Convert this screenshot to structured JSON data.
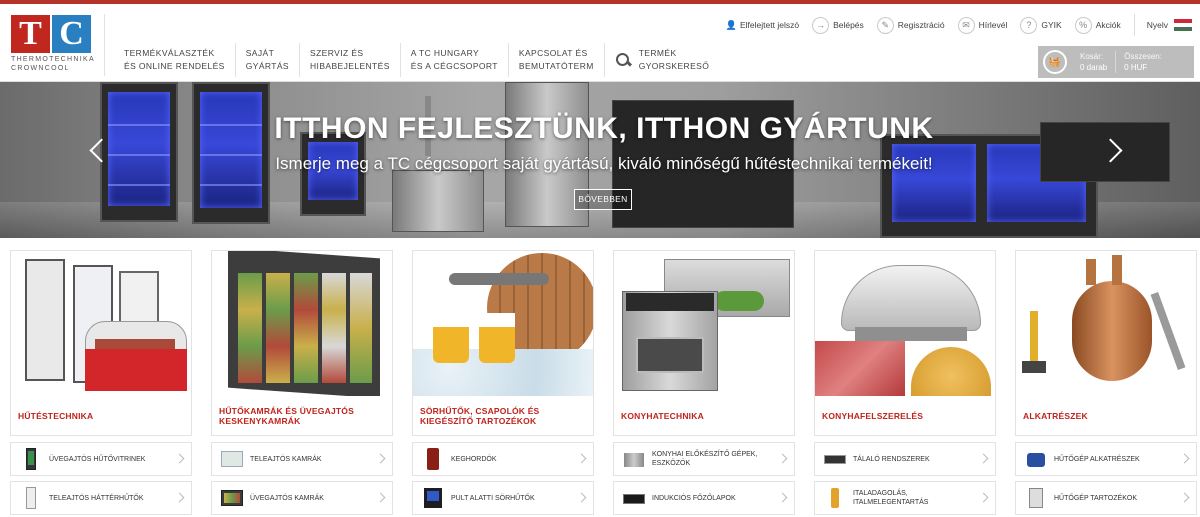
{
  "brand": {
    "logo_letters": [
      "T",
      "C"
    ],
    "logo_line1": "THERMOTECHNIKA",
    "logo_line2": "CROWNCOOL",
    "colors": {
      "accent_red": "#c0231c",
      "logo_blue": "#2a7fc1",
      "top_line": "#b5342a"
    }
  },
  "utility": {
    "forgot_password": "Elfelejtett jelszó",
    "login": "Belépés",
    "register": "Regisztráció",
    "newsletter": "Hírlevél",
    "faq": "GYIK",
    "promotions": "Akciók",
    "language": "Nyelv",
    "icons": [
      "user-icon",
      "login-arrow-icon",
      "register-icon",
      "newsletter-icon",
      "faq-icon",
      "promotions-icon",
      "hungary-flag-icon"
    ]
  },
  "nav": {
    "items": [
      {
        "line1": "TERMÉKVÁLASZTÉK",
        "line2": "ÉS ONLINE RENDELÉS"
      },
      {
        "line1": "SAJÁT",
        "line2": "GYÁRTÁS"
      },
      {
        "line1": "SZERVIZ ÉS",
        "line2": "HIBABEJELENTÉS"
      },
      {
        "line1": "A TC HUNGARY",
        "line2": "ÉS A CÉGCSOPORT"
      },
      {
        "line1": "KAPCSOLAT ÉS",
        "line2": "BEMUTATÓTERM"
      }
    ],
    "search": {
      "line1": "TERMÉK",
      "line2": "GYORSKERESŐ"
    }
  },
  "cart": {
    "cart_label": "Kosár:",
    "cart_value": "0 darab",
    "total_label": "Összesen:",
    "total_value": "0 HUF"
  },
  "hero": {
    "title": "ITTHON FEJLESZTÜNK, ITTHON GYÁRTUNK",
    "subtitle": "Ismerje meg a TC cégcsoport saját gyártású, kiváló minőségű hűtéstechnikai termékeit!",
    "button": "BŐVEBBEN"
  },
  "categories": [
    {
      "title": "HŰTÉSTECHNIKA",
      "subs": [
        {
          "label": "ÜVEGAJTÓS HŰTŐVITRINEK"
        },
        {
          "label": "TELEAJTÓS HÁTTÉRHŰTŐK"
        }
      ]
    },
    {
      "title": "HŰTŐKAMRÁK ÉS ÜVEGAJTÓS KESKENYKAMRÁK",
      "subs": [
        {
          "label": "TELEAJTÓS KAMRÁK"
        },
        {
          "label": "ÜVEGAJTÓS KAMRÁK"
        }
      ]
    },
    {
      "title": "SÖRHŰTŐK, CSAPOLÓK ÉS KIEGÉSZÍTŐ TARTOZÉKOK",
      "subs": [
        {
          "label": "KEGHORDÓK"
        },
        {
          "label": "PULT ALATTI SÖRHŰTŐK"
        }
      ]
    },
    {
      "title": "KONYHATECHNIKA",
      "subs": [
        {
          "label": "KONYHAI ELŐKÉSZÍTŐ GÉPEK, ESZKÖZÖK"
        },
        {
          "label": "INDUKCIÓS FŐZŐLAPOK"
        }
      ]
    },
    {
      "title": "KONYHAFELSZERELÉS",
      "subs": [
        {
          "label": "TÁLALÓ RENDSZEREK"
        },
        {
          "label": "ITALADAGOLÁS, ITALMELEGENTARTÁS"
        }
      ]
    },
    {
      "title": "ALKATRÉSZEK",
      "subs": [
        {
          "label": "HŰTŐGÉP ALKATRÉSZEK"
        },
        {
          "label": "HŰTŐGÉP TARTOZÉKOK"
        }
      ]
    }
  ]
}
